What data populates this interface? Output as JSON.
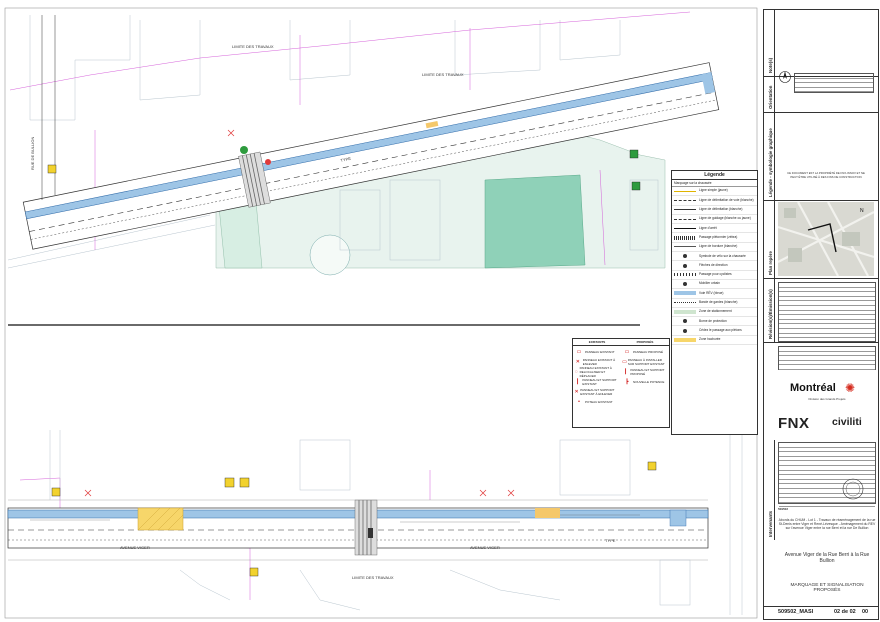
{
  "labels": {
    "limite_travaux": "LIMITE DES TRAVAUX",
    "rue_de_bullion": "RUE DE BULLION",
    "avenue_viger": "AVENUE VIGER",
    "type": "TYPE"
  },
  "legend": {
    "title": "Légende",
    "subtitle": "Marquage sur la chaussée",
    "items": [
      "Ligne simple (jaune)",
      "Ligne de délimitation de voie (blanche)",
      "Ligne de délimitation (blanche)",
      "Ligne de guidage (blanche ou jaune)",
      "Ligne d'arrêt",
      "Passage piétonnier (zébra)",
      "Ligne de bordure (blanche)",
      "Symbole de vélo sur la chaussée",
      "Flèches de direction",
      "Passage pour cyclistes",
      "Mobilier urbain",
      "Voie RÉV (bleue)",
      "Bande de gardes (blanche)",
      "Zone de stationnement",
      "Borne de protection",
      "Cédez le passage aux piétons",
      "Zone hachurée"
    ]
  },
  "signs_table": {
    "existants": "EXISTANTS",
    "proposes": "PROPOSÉS",
    "items_left": [
      "PANNEAU EXISTANT",
      "PANNEAU EXISTANT À ENLEVER",
      "PANNEAU EXISTANT À RELOCALISER ET DÉPLACER",
      "PANNEAU ET SUPPORT EXISTANT",
      "PANNEAU ET SUPPORT EXISTANT À ENLEVER",
      "POTEAU EXISTANT"
    ],
    "items_right": [
      "PANNEAU PROPOSÉ",
      "PANNEAU À INSTALLER SUR SUPPORT EXISTANT",
      "PANNEAU ET SUPPORT PROPOSÉ",
      "NOUVELLE POTENCE"
    ]
  },
  "title_block": {
    "notes": "Note(s)",
    "orientation": "Orientation",
    "legende": "Légende - symbologie graphique",
    "plan_repere": "Plan repère",
    "revisions": "Révision(s)/Émission(s)",
    "intervenants": "Intervenants",
    "montreal": "Montréal",
    "montreal_sub": "Division des Grands Projets",
    "fnx": "FNX",
    "civiliti": "civiliti",
    "doc_notice": "CE DOCUMENT EST LA PROPRIÉTÉ DE FNX-INNOV ET NE PEUT ÊTRE UTILISÉ À DES FINS DE CONSTRUCTION",
    "project_title": "Abords du CHUM - Lot 1 - Travaux de réaménagement de la rue St-Denis entre Viger et René-Lévesque - Aménagement du REV sur l'avenue Viger entre la rue Berri et la rue De Bullion",
    "sheet_title": "Avenue Viger de la Rue Berri à la Rue Bullion",
    "discipline": "MARQUAGE ET SIGNALISATION PROPOSÉS",
    "project_no": "509502",
    "drawing_no": "509502_MASI",
    "sheet": "02 de 02",
    "revision": "00"
  }
}
